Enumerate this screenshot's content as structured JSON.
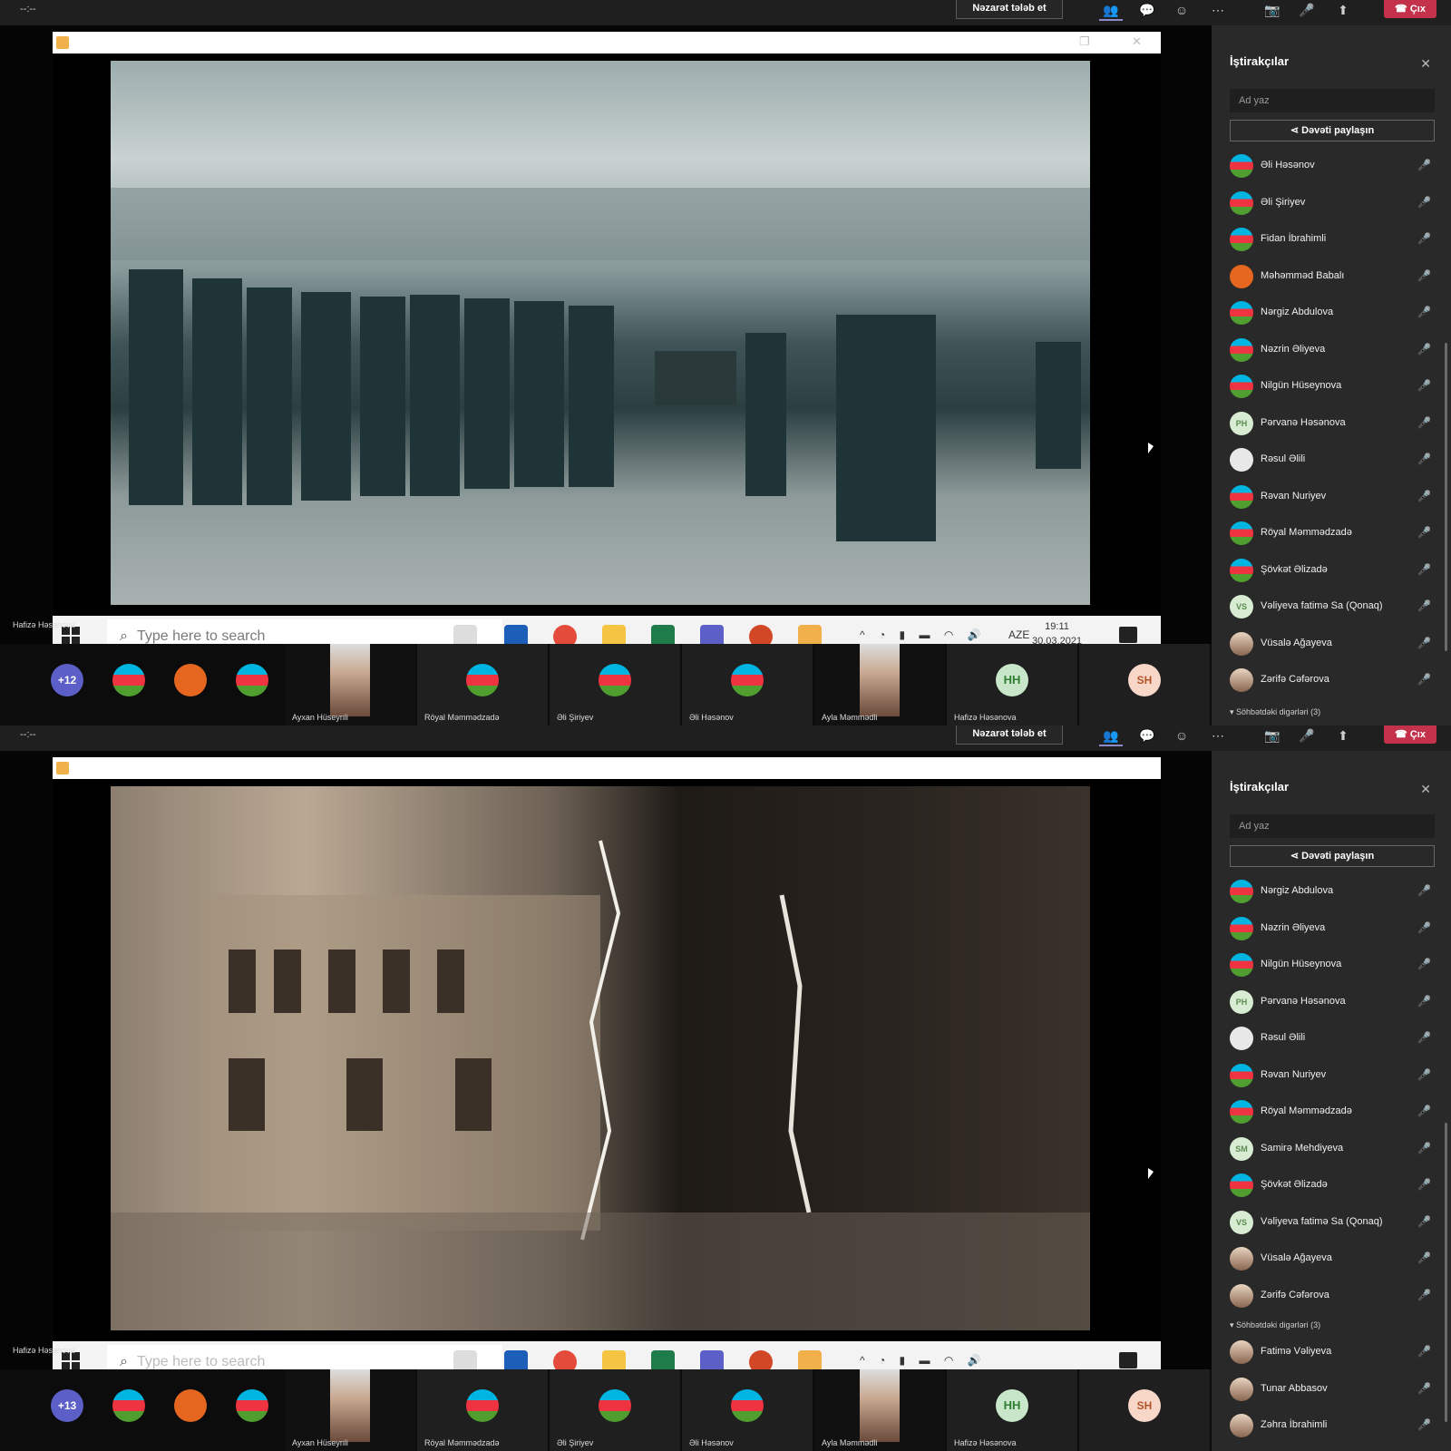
{
  "topbar": {
    "timer": "--:--",
    "request_control_label": "Nəzarət tələb et",
    "leave_label": "Çıx"
  },
  "taskbar": {
    "search_placeholder": "Type here to search",
    "language": "AZE",
    "time": "19:11",
    "date": "30.03.2021"
  },
  "presenter_label": "Hafizə Həsənova",
  "strip": {
    "overflow_counts": [
      "+12",
      "+13"
    ],
    "tiles": [
      {
        "name": "Ayxan Hüseynli",
        "type": "photo"
      },
      {
        "name": "Röyal Məmmədzadə",
        "type": "emblem"
      },
      {
        "name": "Əli Şiriyev",
        "type": "flag"
      },
      {
        "name": "Əli Həsənov",
        "type": "flag"
      },
      {
        "name": "Ayla Məmmədli",
        "type": "photo"
      },
      {
        "name": "Hafizə Həsənova",
        "type": "initials",
        "initials": "HH"
      },
      {
        "name": "",
        "type": "initials",
        "initials": "SH"
      }
    ]
  },
  "panel": {
    "title": "İştirakçılar",
    "search_placeholder": "Ad yaz",
    "share_label": "Dəvəti paylaşın",
    "lobby_label": "Söhbətdəki digərləri (3)",
    "list_1": [
      {
        "name": "Əli Həsənov",
        "avatar": "flag"
      },
      {
        "name": "Əli Şiriyev",
        "avatar": "flag"
      },
      {
        "name": "Fidan İbrahimli",
        "avatar": "flag"
      },
      {
        "name": "Məhəmməd Babalı",
        "avatar": "orange"
      },
      {
        "name": "Nərgiz Abdulova",
        "avatar": "flag"
      },
      {
        "name": "Nəzrin Əliyeva",
        "avatar": "flag"
      },
      {
        "name": "Nilgün Hüseynova",
        "avatar": "flag"
      },
      {
        "name": "Pərvanə Həsənova",
        "avatar": "initials",
        "initials": "PH"
      },
      {
        "name": "Rəsul Əlili",
        "avatar": "white"
      },
      {
        "name": "Rəvan Nuriyev",
        "avatar": "flag"
      },
      {
        "name": "Röyal Məmmədzadə",
        "avatar": "flag"
      },
      {
        "name": "Şövkət Əlizadə",
        "avatar": "flag"
      },
      {
        "name": "Vəliyeva fatimə Sa (Qonaq)",
        "avatar": "initials",
        "initials": "VS"
      },
      {
        "name": "Vüsalə Ağayeva",
        "avatar": "photo"
      },
      {
        "name": "Zərifə Cəfərova",
        "avatar": "photo"
      }
    ],
    "list_2": [
      {
        "name": "Nərgiz Abdulova",
        "avatar": "flag"
      },
      {
        "name": "Nəzrin Əliyeva",
        "avatar": "flag"
      },
      {
        "name": "Nilgün Hüseynova",
        "avatar": "flag"
      },
      {
        "name": "Pərvanə Həsənova",
        "avatar": "initials",
        "initials": "PH"
      },
      {
        "name": "Rəsul Əlili",
        "avatar": "white"
      },
      {
        "name": "Rəvan Nuriyev",
        "avatar": "flag"
      },
      {
        "name": "Röyal Məmmədzadə",
        "avatar": "flag"
      },
      {
        "name": "Samirə Mehdiyeva",
        "avatar": "initials",
        "initials": "SM"
      },
      {
        "name": "Şövkət Əlizadə",
        "avatar": "flag"
      },
      {
        "name": "Vəliyeva fatimə Sa (Qonaq)",
        "avatar": "initials",
        "initials": "VS"
      },
      {
        "name": "Vüsalə Ağayeva",
        "avatar": "photo"
      },
      {
        "name": "Zərifə Cəfərova",
        "avatar": "photo"
      }
    ],
    "list_2_others": [
      {
        "name": "Fatimə Vəliyeva",
        "avatar": "photo"
      },
      {
        "name": "Tunar Abbasov",
        "avatar": "photo"
      },
      {
        "name": "Zəhra İbrahimli",
        "avatar": "photo"
      }
    ]
  }
}
